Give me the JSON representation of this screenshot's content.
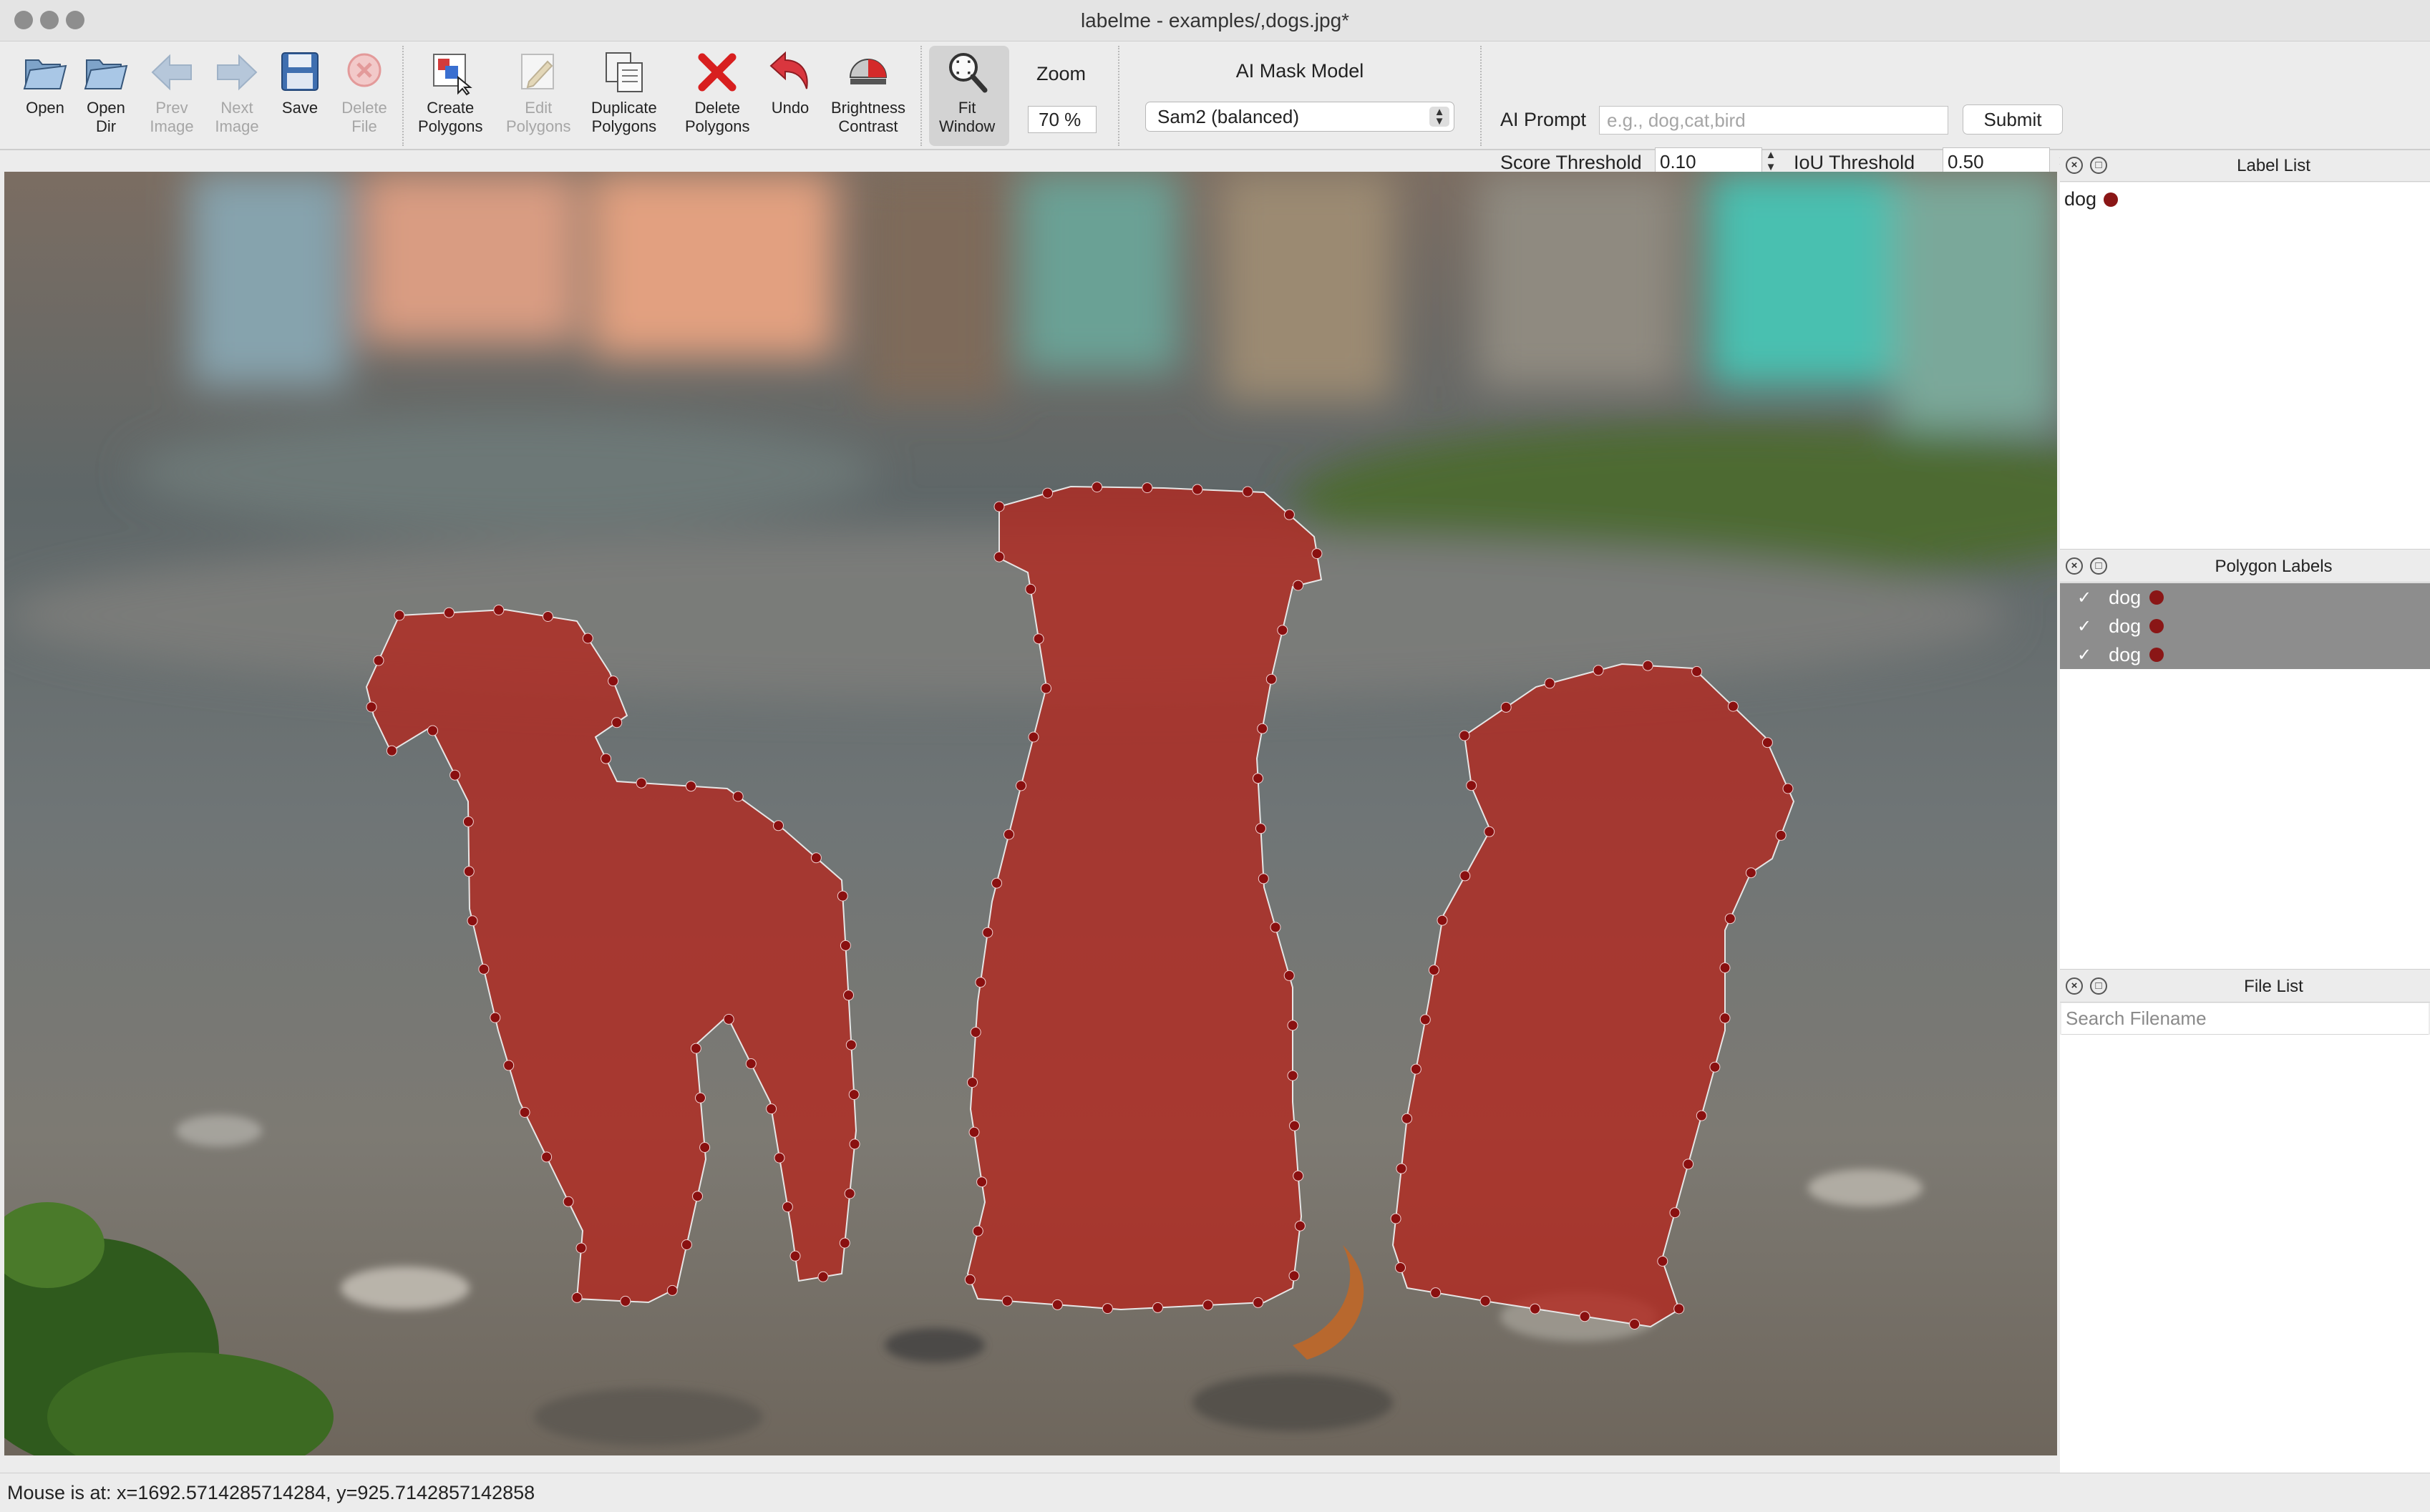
{
  "window": {
    "title": "labelme - examples/,dogs.jpg*"
  },
  "toolbar": {
    "tools": [
      {
        "key": "open",
        "label": "Open",
        "icon": "folder-open-icon",
        "enabled": true
      },
      {
        "key": "open_dir",
        "label": "Open\nDir",
        "icon": "folder-open-icon",
        "enabled": true
      },
      {
        "key": "prev_image",
        "label": "Prev\nImage",
        "icon": "arrow-left-icon",
        "enabled": false
      },
      {
        "key": "next_image",
        "label": "Next\nImage",
        "icon": "arrow-right-icon",
        "enabled": false
      },
      {
        "key": "save",
        "label": "Save",
        "icon": "floppy-disk-icon",
        "enabled": true
      },
      {
        "key": "delete_file",
        "label": "Delete\nFile",
        "icon": "delete-circle-icon",
        "enabled": false
      },
      {
        "key": "create_polygons",
        "label": "Create\nPolygons",
        "icon": "create-polygon-icon",
        "enabled": true
      },
      {
        "key": "edit_polygons",
        "label": "Edit\nPolygons",
        "icon": "edit-pencil-icon",
        "enabled": false
      },
      {
        "key": "duplicate_polygons",
        "label": "Duplicate\nPolygons",
        "icon": "duplicate-icon",
        "enabled": true
      },
      {
        "key": "delete_polygons",
        "label": "Delete\nPolygons",
        "icon": "red-x-icon",
        "enabled": true
      },
      {
        "key": "undo",
        "label": "Undo",
        "icon": "undo-arrow-icon",
        "enabled": true
      },
      {
        "key": "brightness_contrast",
        "label": "Brightness\nContrast",
        "icon": "brightness-contrast-icon",
        "enabled": true
      },
      {
        "key": "fit_window",
        "label": "Fit\nWindow",
        "icon": "zoom-fit-icon",
        "enabled": true
      }
    ],
    "zoom": {
      "caption": "Zoom",
      "value": "70 %"
    },
    "ai_model": {
      "caption": "AI Mask Model",
      "selected": "Sam2 (balanced)"
    },
    "ai_prompt": {
      "caption": "AI Prompt",
      "placeholder": "e.g., dog,cat,bird",
      "value": "",
      "submit_label": "Submit"
    },
    "score_threshold": {
      "caption": "Score Threshold",
      "value": "0.10"
    },
    "iou_threshold": {
      "caption": "IoU Threshold",
      "value": "0.50"
    }
  },
  "canvas": {
    "image_subject": "three puppies on gravel path",
    "polygon_fill": "#b3261e",
    "vertex_color": "#8a1010"
  },
  "docks": {
    "label_list": {
      "title": "Label List",
      "items": [
        {
          "label": "dog",
          "color": "#8a1616"
        }
      ]
    },
    "polygon_labels": {
      "title": "Polygon Labels",
      "items": [
        {
          "label": "dog",
          "checked": true,
          "color": "#8a1616"
        },
        {
          "label": "dog",
          "checked": true,
          "color": "#8a1616"
        },
        {
          "label": "dog",
          "checked": true,
          "color": "#8a1616"
        }
      ]
    },
    "file_list": {
      "title": "File List",
      "search_placeholder": "Search Filename"
    }
  },
  "status": {
    "text": "Mouse is at: x=1692.5714285714284, y=925.7142857142858"
  },
  "icons": {
    "close": "close-icon",
    "float": "float-icon",
    "check": "check-icon",
    "stepper": "stepper-arrows-icon"
  }
}
